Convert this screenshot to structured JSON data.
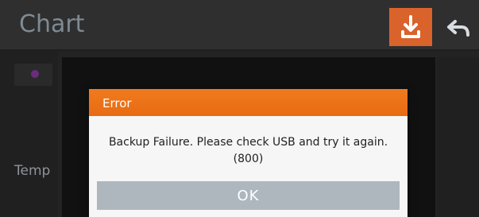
{
  "header": {
    "title": "Chart",
    "actions": [
      {
        "name": "download",
        "icon": "download-icon"
      },
      {
        "name": "back",
        "icon": "back-arrow-icon"
      }
    ]
  },
  "side_panel": {
    "label": "Temp",
    "series_color": "#6b2c7f"
  },
  "dialog": {
    "title": "Error",
    "message": "Backup Failure. Please check USB and try it again.",
    "code": "(800)",
    "ok_label": "OK"
  },
  "colors": {
    "accent": "#e86b12",
    "button_gray": "#aeb6be",
    "background": "#232323"
  }
}
